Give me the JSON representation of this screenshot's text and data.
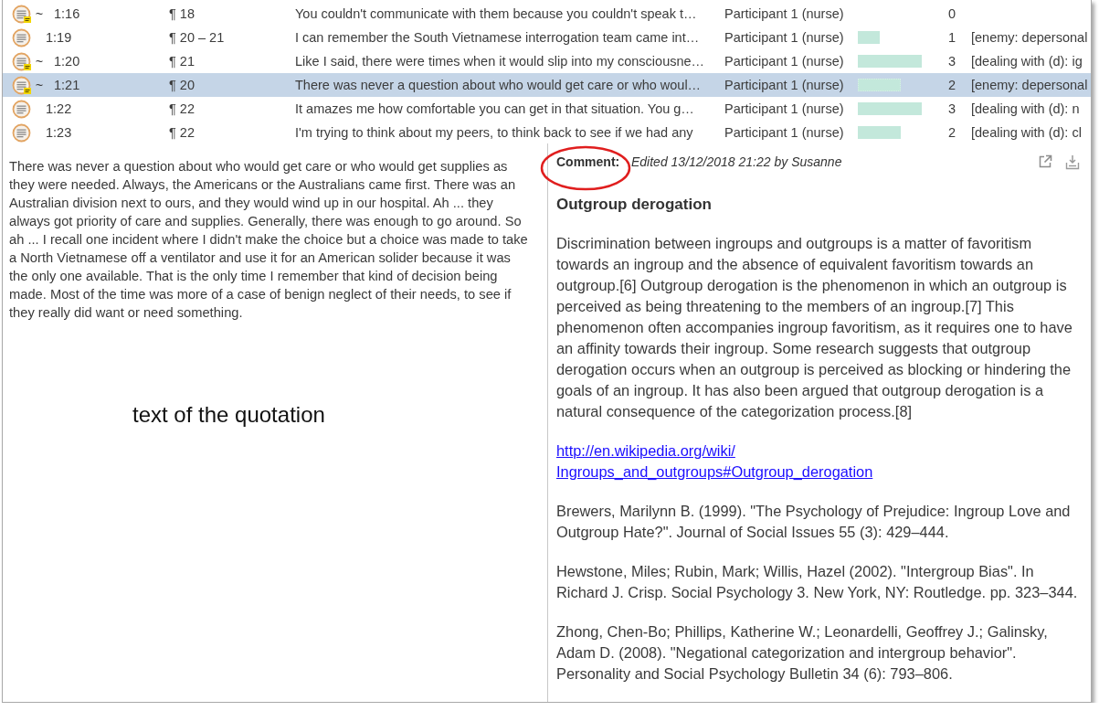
{
  "quotations": {
    "rows": [
      {
        "selected": false,
        "commented": true,
        "prefix": "~",
        "id": "1:16",
        "paragraph": "¶ 18",
        "text": "You couldn't communicate with them because you couldn't speak t…",
        "document": "Participant 1 (nurse)",
        "count": "0"
      },
      {
        "selected": false,
        "commented": false,
        "id": "1:19",
        "paragraph": "¶ 20 – 21",
        "text": "I can remember the South Vietnamese interrogation team came int…",
        "document": "Participant 1 (nurse)",
        "level": 0.34,
        "count": "1",
        "codes": "[enemy: depersonal"
      },
      {
        "selected": false,
        "commented": true,
        "prefix": "~",
        "id": "1:20",
        "paragraph": "¶ 21",
        "text": "Like I said, there were times when it would slip into my consciousne…",
        "document": "Participant 1 (nurse)",
        "level": 1,
        "count": "3",
        "codes": "[dealing with (d): ig"
      },
      {
        "selected": true,
        "commented": true,
        "prefix": "~",
        "id": "1:21",
        "paragraph": "¶ 20",
        "text": "There was never a question about who would get care or who woul…",
        "document": "Participant 1 (nurse)",
        "level": 0.67,
        "count": "2",
        "codes": "[enemy: depersonal"
      },
      {
        "selected": false,
        "commented": false,
        "id": "1:22",
        "paragraph": "¶ 22",
        "text": "It amazes me how comfortable you can get in that situation. You g…",
        "document": "Participant 1 (nurse)",
        "level": 1,
        "count": "3",
        "codes": "[dealing with (d): n"
      },
      {
        "selected": false,
        "commented": false,
        "id": "1:23",
        "paragraph": "¶ 22",
        "text": "I'm trying to think about my peers, to think back to see if we had any",
        "document": "Participant 1 (nurse)",
        "level": 0.67,
        "count": "2",
        "codes": "[dealing with (d): cl"
      }
    ]
  },
  "quotation_pane": {
    "text": "There was never a question about who would get care or who would get supplies as they were needed. Always, the Americans or the Australians came first. There was an Australian division next to ours, and they would wind up in our hospital. Ah ... they always got priority of care and supplies. Generally, there was enough to go around. So ah ... I recall one incident where I didn't make the choice but a choice was made to take a North Vietnamese off a ventilator and use it for an American solider because it was the only one available. That is the only time I remember that kind of decision being made. Most of the time was more of a case of benign neglect of their needs, to see if they really did want or need something.",
    "callout": "text of the quotation"
  },
  "comment_pane": {
    "label": "Comment:",
    "meta": "Edited 13/12/2018 21:22 by Susanne",
    "blocks": [
      {
        "kind": "heading",
        "text": "Outgroup derogation"
      },
      {
        "kind": "paragraph",
        "text": "Discrimination between ingroups and outgroups is a matter of favoritism towards an ingroup and the absence of equivalent favoritism towards an outgroup.[6] Outgroup derogation is the phenomenon in which an outgroup is perceived as being threatening to the members of an ingroup.[7] This phenomenon often accompanies ingroup favoritism, as it requires one to have an affinity towards their ingroup. Some research suggests that outgroup derogation occurs when an outgroup is perceived as blocking or hindering the goals of an ingroup. It has also been argued that outgroup derogation is a natural consequence of the categorization process.[8]"
      },
      {
        "kind": "link",
        "lines": [
          "http://en.wikipedia.org/wiki/",
          "Ingroups_and_outgroups#Outgroup_derogation"
        ]
      },
      {
        "kind": "paragraph",
        "text": "Brewers, Marilynn B. (1999). \"The Psychology of Prejudice: Ingroup Love and Outgroup Hate?\". Journal of Social Issues 55 (3): 429–444."
      },
      {
        "kind": "paragraph",
        "text": "Hewstone, Miles; Rubin, Mark; Willis, Hazel (2002). \"Intergroup Bias\". In Richard J. Crisp. Social Psychology 3. New York, NY: Routledge. pp. 323–344."
      },
      {
        "kind": "paragraph",
        "text": "Zhong, Chen-Bo; Phillips, Katherine W.; Leonardelli, Geoffrey J.; Galinsky, Adam D. (2008). \"Negational categorization and intergroup behavior\". Personality and Social Psychology Bulletin 34 (6): 793–806."
      }
    ]
  }
}
